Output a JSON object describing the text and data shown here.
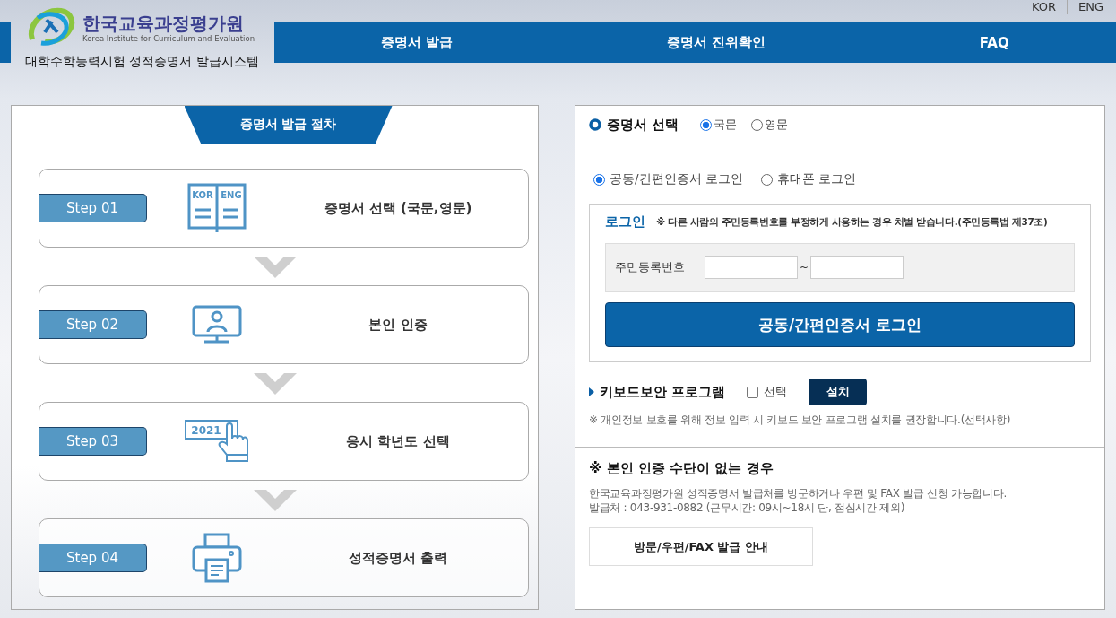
{
  "header": {
    "logo": {
      "name_ko": "한국교육과정평가원",
      "name_en": "Korea Institute for Curriculum and Evaluation",
      "system_title": "대학수학능력시험 성적증명서 발급시스템"
    },
    "languages": [
      {
        "label": "KOR"
      },
      {
        "label": "ENG"
      }
    ],
    "nav": [
      {
        "label": "증명서 발급"
      },
      {
        "label": "증명서 진위확인"
      },
      {
        "label": "FAQ"
      }
    ]
  },
  "procedure": {
    "title": "증명서 발급 절차",
    "steps": [
      {
        "badge": "Step 01",
        "kind": "book",
        "icon_labels": [
          "KOR",
          "ENG"
        ],
        "title": "증명서 선택 (국문,영문)"
      },
      {
        "badge": "Step 02",
        "kind": "monitor",
        "title": "본인 인증"
      },
      {
        "badge": "Step 03",
        "kind": "year",
        "icon_labels": [
          "2021"
        ],
        "title": "응시 학년도 선택"
      },
      {
        "badge": "Step 04",
        "kind": "printer",
        "title": "성적증명서 출력"
      }
    ]
  },
  "certificate": {
    "title": "증명서 선택",
    "options": [
      {
        "label": "국문",
        "selected": true
      },
      {
        "label": "영문",
        "selected": false
      }
    ]
  },
  "login_methods": [
    {
      "label": "공동/간편인증서 로그인",
      "selected": true
    },
    {
      "label": "휴대폰 로그인",
      "selected": false
    }
  ],
  "login": {
    "title": "로그인",
    "notice": "※ 다른 사람의 주민등록번호를 부정하게 사용하는 경우 처벌 받습니다.(주민등록법 제37조)",
    "field_label": "주민등록번호",
    "separator": "~",
    "button": "공동/간편인증서 로그인"
  },
  "keyboard": {
    "title": "키보드보안 프로그램",
    "checkbox": {
      "label": "선택",
      "checked": false
    },
    "button": "설치",
    "note": "※ 개인정보 보호를 위해 정보 입력 시 키보드 보안 프로그램 설치를 권장합니다.(선택사항)"
  },
  "no_auth": {
    "title": "※ 본인 인증 수단이 없는 경우",
    "lines": [
      "한국교육과정평가원 성적증명서 발급처를 방문하거나 우편 및 FAX 발급 신청 가능합니다.",
      "발급처 : 043-931-0882 (근무시간: 09시~18시 단, 점심시간 제외)"
    ],
    "button": "방문/우편/FAX 발급 안내"
  }
}
